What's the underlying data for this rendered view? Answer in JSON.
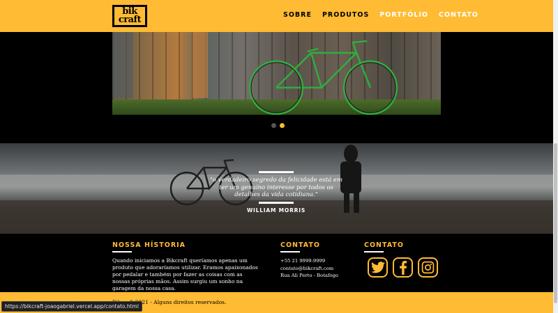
{
  "header": {
    "logo_line1": "bik",
    "logo_line2": "craft",
    "nav": [
      {
        "label": "SOBRE",
        "active": false
      },
      {
        "label": "PRODUTOS",
        "active": false
      },
      {
        "label": "PORTFÓLIO",
        "active": true
      },
      {
        "label": "CONTATO",
        "active": true
      }
    ]
  },
  "slider": {
    "current_slide": 2,
    "total_slides": 2
  },
  "quote": {
    "text": "\"o verdadeiro segredo da felicidade está em ter um genuíno interesse por todos os detalhes da vida cotidiana.\"",
    "author": "WILLIAM MORRIS"
  },
  "footer": {
    "historia_title": "NOSSA HÍSTORIA",
    "historia_text": "Quando iniciamos a Bikcraft queríamos apenas um produto que adoraríamos utilizar. Eramos apaixonados por pedalar e também por fazer as coisas com as nossas próprias mãos. Assim surgiu um sonho na garagem da nossa casa.",
    "contato_title": "CONTATO",
    "contato_items": [
      "+55 21 9999-9999",
      "contato@bikcraft.com",
      "Rua Ali Perto - Botafogo"
    ],
    "social_title": "CONTATO",
    "social_icons": [
      "twitter-icon",
      "facebook-icon",
      "instagram-icon"
    ]
  },
  "copyright": "Bikcraft 2021 - Alguns direitos reservados.",
  "status_url": "https://bikcraft-joaogabriel.vercel.app/contato.html",
  "colors": {
    "accent": "#ffbb33",
    "background": "#000000",
    "text_light": "#ffffff"
  }
}
